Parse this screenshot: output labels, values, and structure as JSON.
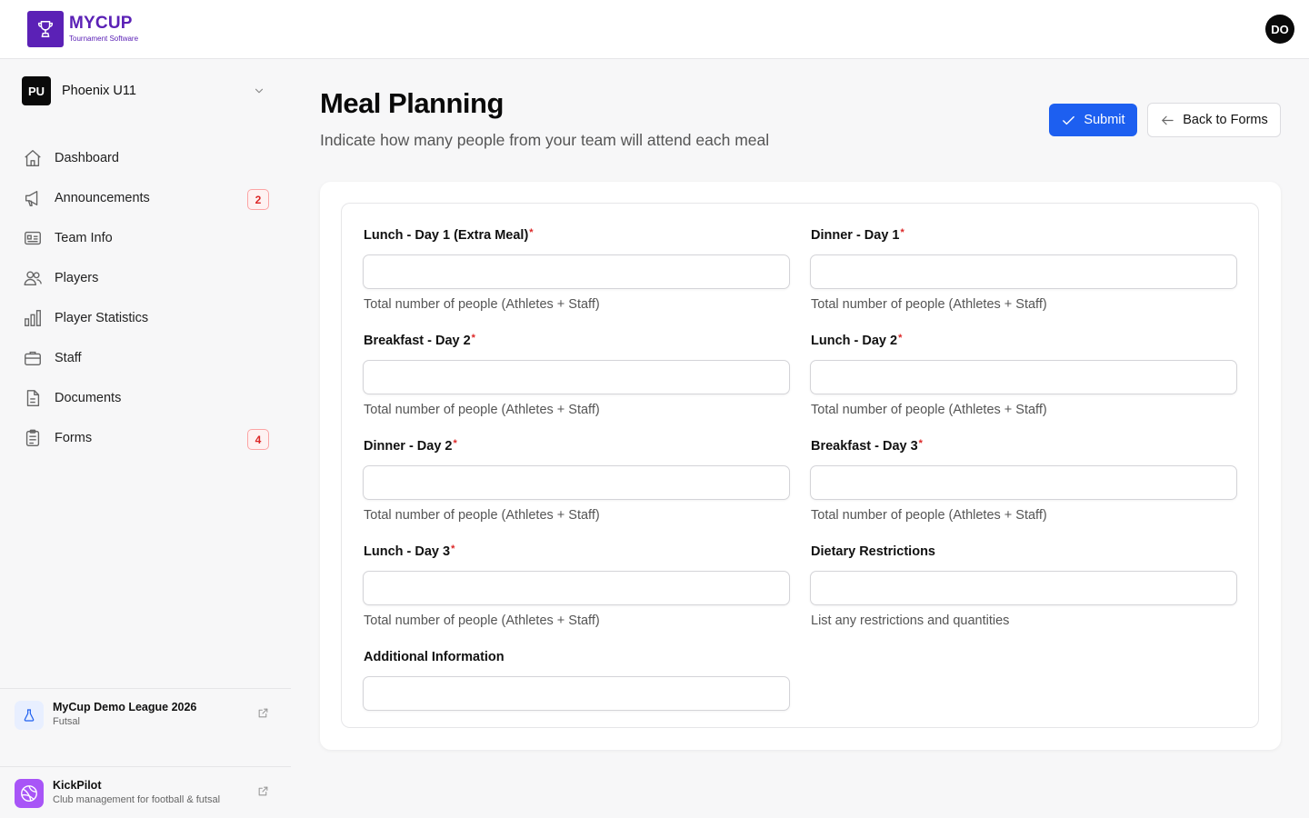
{
  "header": {
    "logo_title": "MYCUP",
    "logo_subtitle": "Tournament Software",
    "user_initials": "DO"
  },
  "sidebar": {
    "team_initials": "PU",
    "team_name": "Phoenix U11",
    "items": [
      {
        "label": "Dashboard",
        "icon": "home-icon"
      },
      {
        "label": "Announcements",
        "icon": "megaphone-icon",
        "badge": "2"
      },
      {
        "label": "Team Info",
        "icon": "id-card-icon"
      },
      {
        "label": "Players",
        "icon": "users-icon"
      },
      {
        "label": "Player Statistics",
        "icon": "bar-chart-icon"
      },
      {
        "label": "Staff",
        "icon": "briefcase-icon"
      },
      {
        "label": "Documents",
        "icon": "document-icon"
      },
      {
        "label": "Forms",
        "icon": "clipboard-icon",
        "badge": "4"
      }
    ],
    "league": {
      "title": "MyCup Demo League 2026",
      "subtitle": "Futsal"
    },
    "app": {
      "title": "KickPilot",
      "subtitle": "Club management for football & futsal"
    }
  },
  "main": {
    "title": "Meal Planning",
    "subtitle": "Indicate how many people from your team will attend each meal",
    "submit_label": "Submit",
    "back_label": "Back to Forms",
    "fields": [
      {
        "label": "Lunch - Day 1 (Extra Meal)",
        "required": "*",
        "value": "",
        "help": "Total number of people (Athletes + Staff)"
      },
      {
        "label": "Dinner - Day 1",
        "required": "*",
        "value": "",
        "help": "Total number of people (Athletes + Staff)"
      },
      {
        "label": "Breakfast - Day 2",
        "required": "*",
        "value": "",
        "help": "Total number of people (Athletes + Staff)"
      },
      {
        "label": "Lunch - Day 2",
        "required": "*",
        "value": "",
        "help": "Total number of people (Athletes + Staff)"
      },
      {
        "label": "Dinner - Day 2",
        "required": "*",
        "value": "",
        "help": "Total number of people (Athletes + Staff)"
      },
      {
        "label": "Breakfast - Day 3",
        "required": "*",
        "value": "",
        "help": "Total number of people (Athletes + Staff)"
      },
      {
        "label": "Lunch - Day 3",
        "required": "*",
        "value": "",
        "help": "Total number of people (Athletes + Staff)"
      },
      {
        "label": "Dietary Restrictions",
        "value": "",
        "help": "List any restrictions and quantities"
      },
      {
        "label": "Additional Information",
        "value": ""
      }
    ]
  },
  "colors": {
    "brand": "#5b21b6",
    "primary": "#1d5ff0",
    "danger": "#dc2626"
  }
}
